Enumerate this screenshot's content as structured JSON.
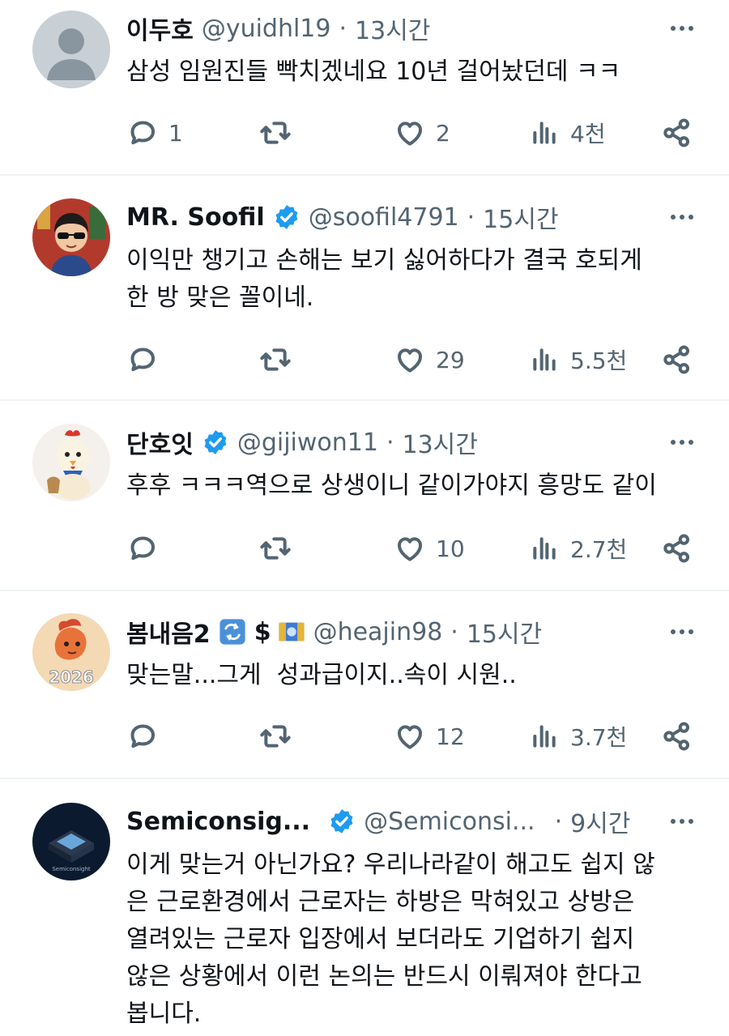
{
  "tweets": [
    {
      "name": "이두호",
      "handle": "@yuidhl19",
      "dot": "·",
      "time": "13시간",
      "text": "삼성 임원진들 빡치겠네요 10년 걸어놨던데 ㅋㅋ",
      "replies": "1",
      "likes": "2",
      "views": "4천",
      "verified": false
    },
    {
      "name": "MR. Soofil",
      "handle": "@soofil4791",
      "dot": "·",
      "time": "15시간",
      "text": "이익만 챙기고 손해는 보기 싫어하다가 결국 호되게\n한 방 맞은 꼴이네.",
      "replies": "",
      "likes": "29",
      "views": "5.5천",
      "verified": true
    },
    {
      "name": "단호잇",
      "handle": "@gijiwon11",
      "dot": "·",
      "time": "13시간",
      "text": "후후 ㅋㅋㅋ역으로 상생이니 같이가야지 흥망도 같이",
      "replies": "",
      "likes": "10",
      "views": "2.7천",
      "verified": true
    },
    {
      "name": "봄내음2",
      "name_suffix": "$",
      "handle": "@heajin98",
      "dot": "·",
      "time": "15시간",
      "text": "맞는말...그게  성과급이지..속이 시원..",
      "replies": "",
      "likes": "12",
      "views": "3.7천",
      "verified": false
    },
    {
      "name": "Semiconsig...",
      "handle": "@Semiconsi...",
      "dot": "·",
      "time": "9시간",
      "text": "이게 맞는거 아닌가요? 우리나라같이 해고도 쉽지 않\n은 근로환경에서 근로자는 하방은 막혀있고 상방은\n열려있는 근로자 입장에서 보더라도 기업하기 쉽지\n않은 상황에서 이런 논의는 반드시 이뤄져야 한다고\n봅니다.",
      "verified": true
    }
  ],
  "avatars": {
    "t4_year": "2026",
    "t5_label": "Semiconsight"
  },
  "icons": {
    "reply": "reply-icon",
    "retweet": "retweet-icon",
    "like": "heart-icon",
    "views": "views-icon",
    "share": "share-icon",
    "more": "more-icon",
    "verified": "verified-badge-icon"
  },
  "colors": {
    "text": "#0f1419",
    "muted": "#536471",
    "verified": "#1d9bf0",
    "divider": "#eff3f4"
  }
}
